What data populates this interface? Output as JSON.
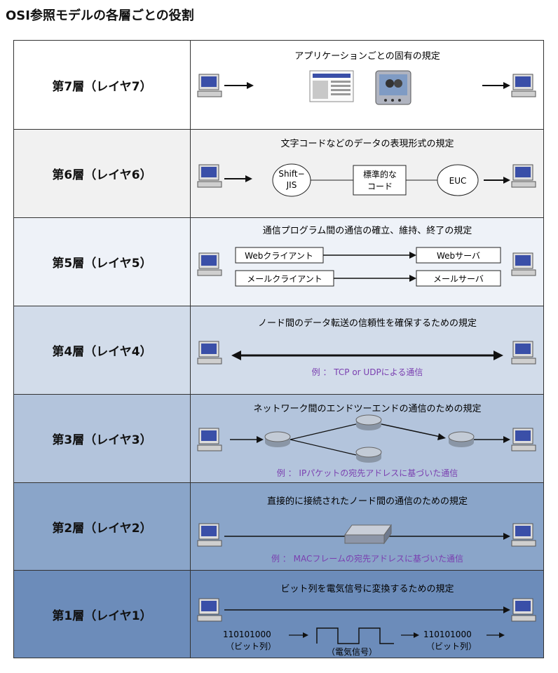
{
  "page_title": "OSI参照モデルの各層ごとの役割",
  "layers": [
    {
      "label": "第7層（レイヤ7）",
      "description": "アプリケーションごとの固有の規定",
      "bg": "#ffffff"
    },
    {
      "label": "第6層（レイヤ6）",
      "description": "文字コードなどのデータの表現形式の規定",
      "bg": "#f1f1f1",
      "nodes": {
        "shift_jis_top": "Shift−",
        "shift_jis_bottom": "JIS",
        "std_top": "標準的な",
        "std_bottom": "コード",
        "euc": "EUC"
      }
    },
    {
      "label": "第5層（レイヤ5）",
      "description": "通信プログラム間の通信の確立、維持、終了の規定",
      "bg": "#eef2f8",
      "nodes": {
        "web_client": "Webクライアント",
        "web_server": "Webサーバ",
        "mail_client": "メールクライアント",
        "mail_server": "メールサーバ"
      }
    },
    {
      "label": "第4層（レイヤ4）",
      "description": "ノード間のデータ転送の信頼性を確保するための規定",
      "bg": "#d2dcea",
      "example": "例 ： TCP or UDPによる通信"
    },
    {
      "label": "第3層（レイヤ3）",
      "description": "ネットワーク間のエンドツーエンドの通信のための規定",
      "bg": "#b3c4dc",
      "example": "例 ： IPパケットの宛先アドレスに基づいた通信"
    },
    {
      "label": "第2層（レイヤ2）",
      "description": "直接的に接続されたノード間の通信のための規定",
      "bg": "#8aa5c9",
      "example": "例 ： MACフレームの宛先アドレスに基づいた通信"
    },
    {
      "label": "第1層（レイヤ1）",
      "description": "ビット列を電気信号に変換するための規定",
      "bg": "#6c8cba",
      "bits": "110101000",
      "bits_note": "（ビット列）",
      "signal_note": "（電気信号）"
    }
  ],
  "colors": {
    "example_text": "#7a3fb0",
    "line": "#111111",
    "pc_screen": "#3a4fa8"
  }
}
